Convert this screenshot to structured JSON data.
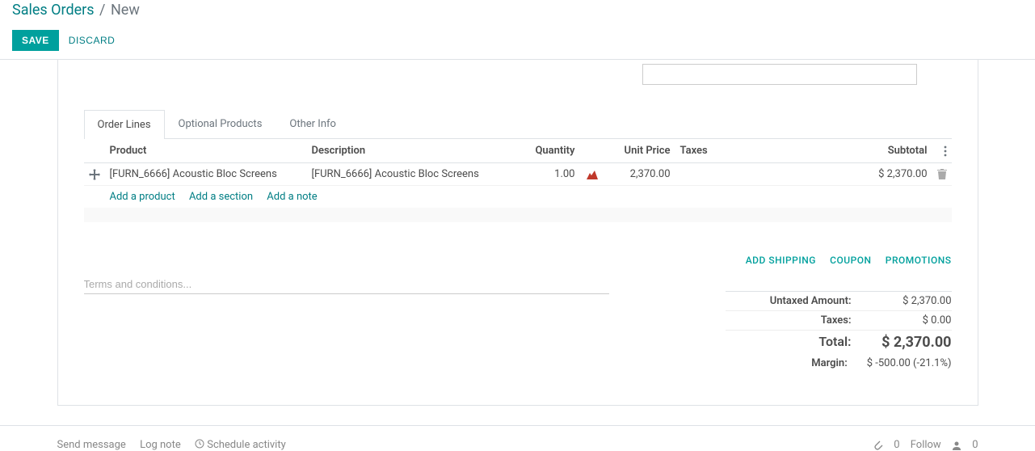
{
  "breadcrumb": {
    "parent": "Sales Orders",
    "current": "New"
  },
  "buttons": {
    "save": "SAVE",
    "discard": "DISCARD"
  },
  "tabs": [
    {
      "label": "Order Lines",
      "active": true
    },
    {
      "label": "Optional Products",
      "active": false
    },
    {
      "label": "Other Info",
      "active": false
    }
  ],
  "columns": {
    "product": "Product",
    "description": "Description",
    "quantity": "Quantity",
    "unit_price": "Unit Price",
    "taxes": "Taxes",
    "subtotal": "Subtotal"
  },
  "lines": [
    {
      "product": "[FURN_6666] Acoustic Bloc Screens",
      "description": "[FURN_6666] Acoustic Bloc Screens",
      "quantity": "1.00",
      "unit_price": "2,370.00",
      "taxes": "",
      "subtotal": "$ 2,370.00"
    }
  ],
  "add_links": {
    "product": "Add a product",
    "section": "Add a section",
    "note": "Add a note"
  },
  "terms_placeholder": "Terms and conditions...",
  "actions": {
    "shipping": "ADD SHIPPING",
    "coupon": "COUPON",
    "promotions": "PROMOTIONS"
  },
  "totals": {
    "untaxed_label": "Untaxed Amount:",
    "untaxed_value": "$ 2,370.00",
    "taxes_label": "Taxes:",
    "taxes_value": "$ 0.00",
    "total_label": "Total:",
    "total_value": "$ 2,370.00",
    "margin_label": "Margin:",
    "margin_value": "$ -500.00 (-21.1%)"
  },
  "footer": {
    "send_message": "Send message",
    "log_note": "Log note",
    "schedule": "Schedule activity",
    "attach_count": "0",
    "follow": "Follow",
    "follower_count": "0"
  }
}
